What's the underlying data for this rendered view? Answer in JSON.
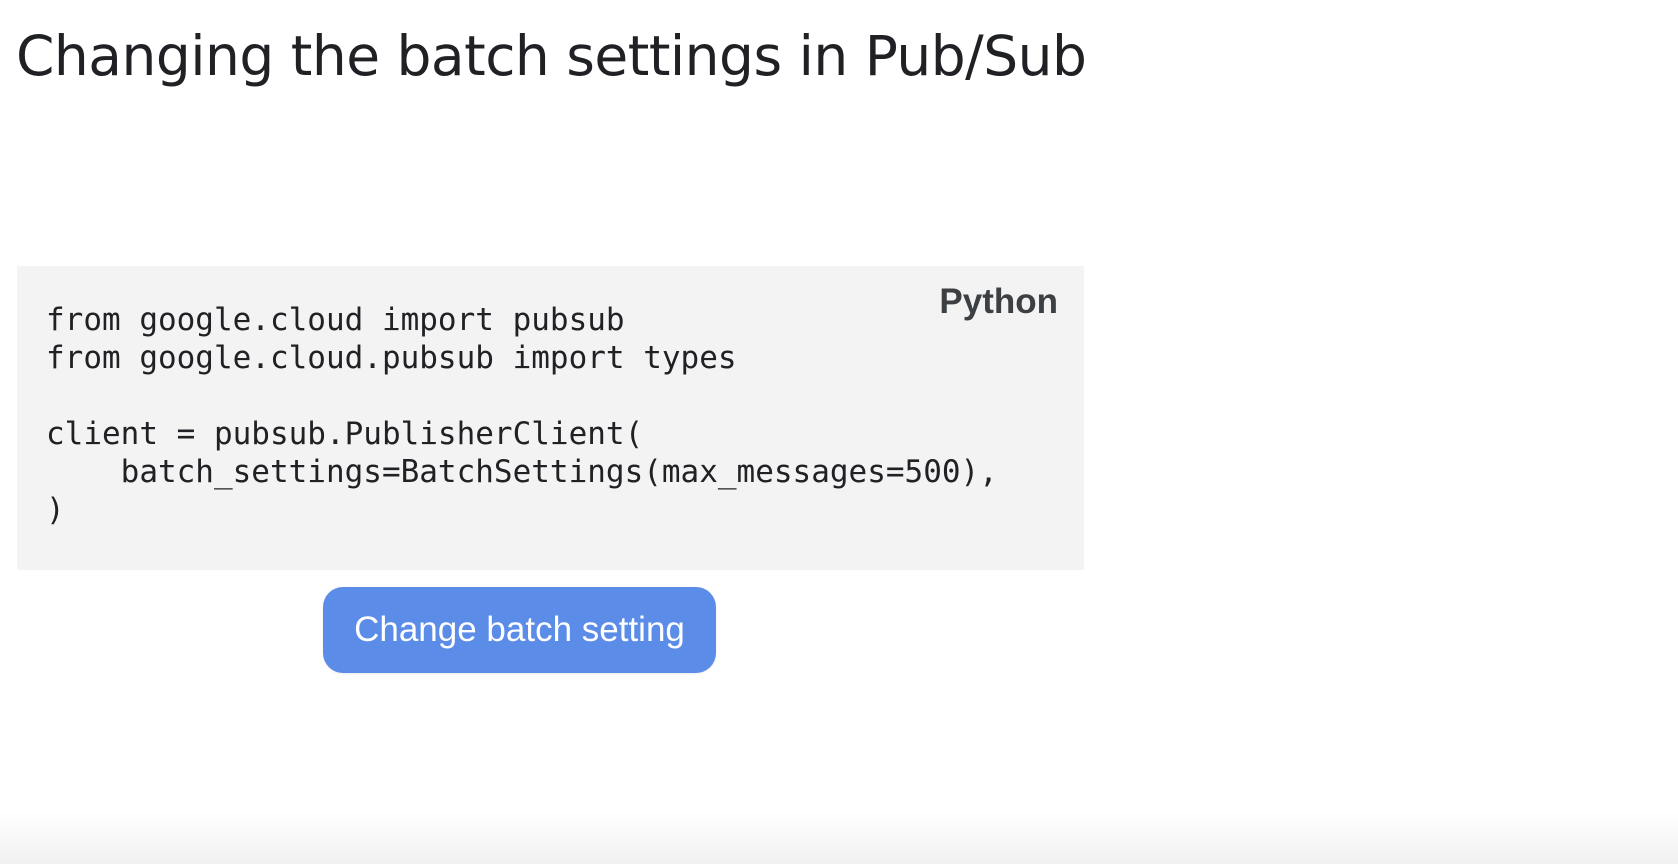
{
  "slide": {
    "title": "Changing the batch settings in Pub/Sub"
  },
  "code_card": {
    "language": "Python",
    "lines": [
      "from google.cloud import pubsub",
      "from google.cloud.pubsub import types",
      "",
      "client = pubsub.PublisherClient(",
      "    batch_settings=BatchSettings(max_messages=500),",
      ")"
    ]
  },
  "action": {
    "label": "Change batch setting"
  },
  "colors": {
    "button": "#5b8ce8",
    "code_background": "#f3f3f3",
    "text": "#202124"
  }
}
